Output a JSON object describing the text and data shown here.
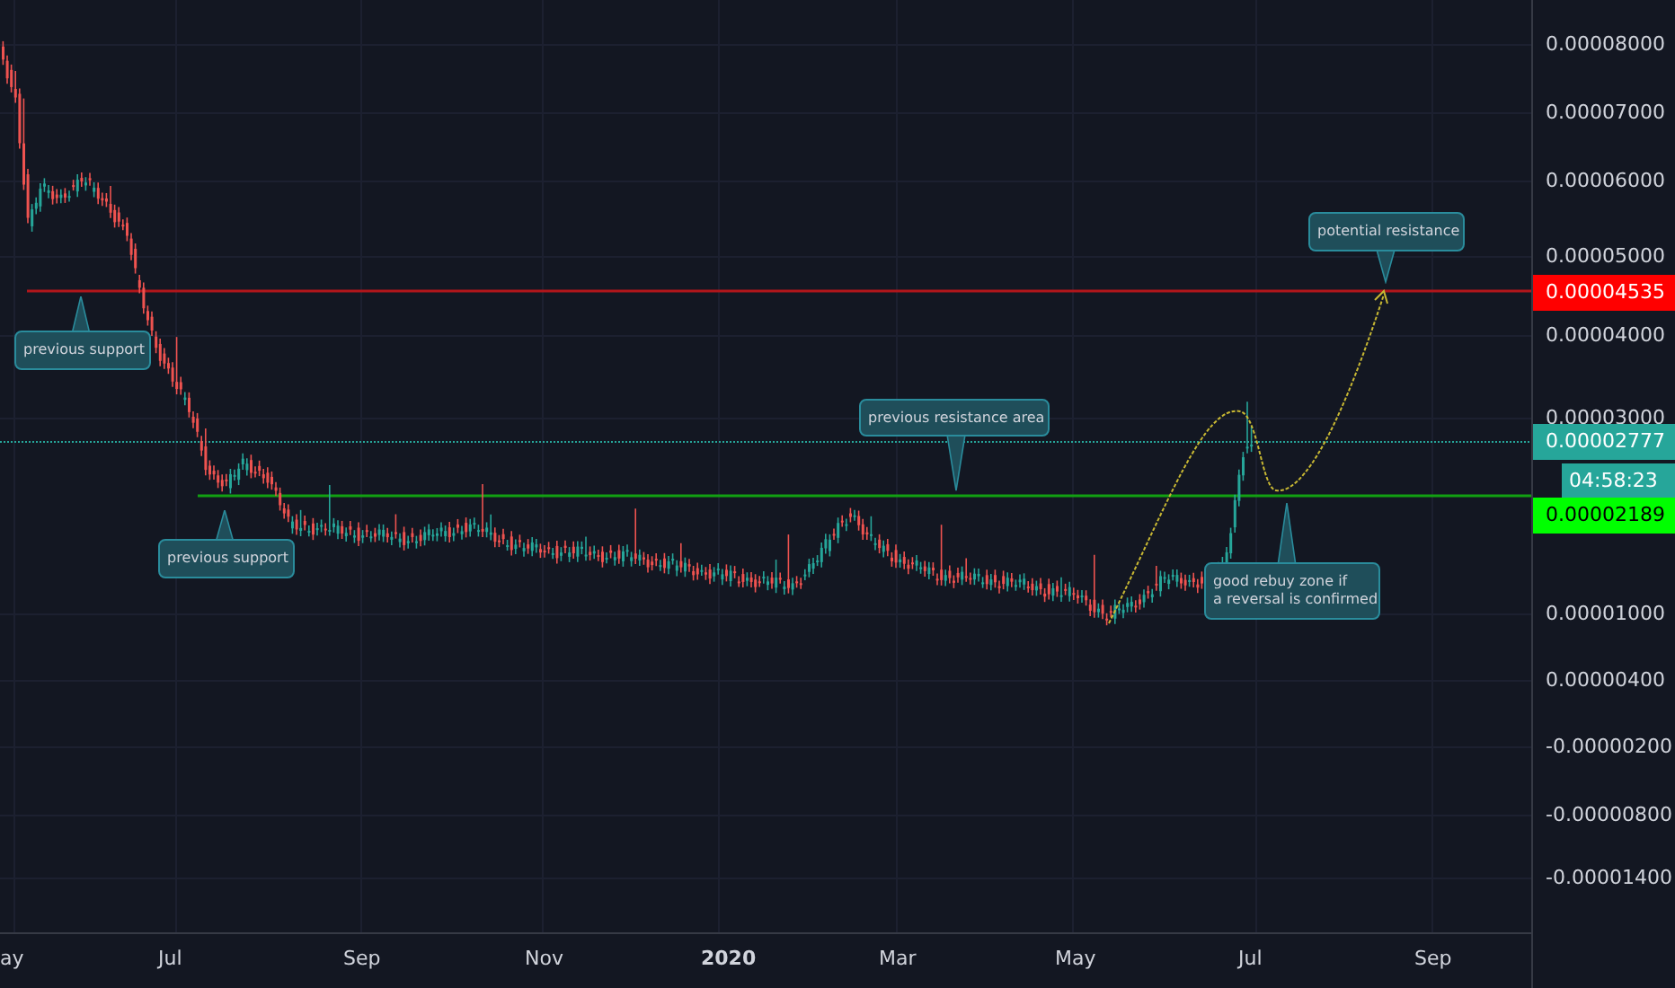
{
  "price_axis": {
    "labels": [
      "0.00008000",
      "0.00007000",
      "0.00006000",
      "0.00005000",
      "0.00004000",
      "0.00003000",
      "0.00001000",
      "0.00000400",
      "-0.00000200",
      "-0.00000800",
      "-0.00001400"
    ]
  },
  "price_badges": [
    {
      "text": "0.00004535",
      "kind": "level",
      "color": "#ff0000"
    },
    {
      "text": "0.00002777",
      "kind": "last",
      "color": "#26a69a"
    },
    {
      "text": "04:58:23",
      "kind": "countdown",
      "color": "#26a69a"
    },
    {
      "text": "0.00002189",
      "kind": "level",
      "color": "#00ff00"
    }
  ],
  "time_axis": {
    "labels": [
      {
        "text": "ay",
        "kind": "month"
      },
      {
        "text": "Jul",
        "kind": "month"
      },
      {
        "text": "Sep",
        "kind": "month"
      },
      {
        "text": "Nov",
        "kind": "month"
      },
      {
        "text": "2020",
        "kind": "year"
      },
      {
        "text": "Mar",
        "kind": "month"
      },
      {
        "text": "May",
        "kind": "month"
      },
      {
        "text": "Jul",
        "kind": "month"
      },
      {
        "text": "Sep",
        "kind": "month"
      }
    ]
  },
  "callouts": [
    {
      "lines": [
        "previous support"
      ],
      "kind": "up"
    },
    {
      "lines": [
        "previous support"
      ],
      "kind": "up"
    },
    {
      "lines": [
        "previous resistance area"
      ],
      "kind": "down"
    },
    {
      "lines": [
        "potential resistance"
      ],
      "kind": "down"
    },
    {
      "lines": [
        "good rebuy zone if",
        "a reversal is confirmed"
      ],
      "kind": "up"
    }
  ]
}
